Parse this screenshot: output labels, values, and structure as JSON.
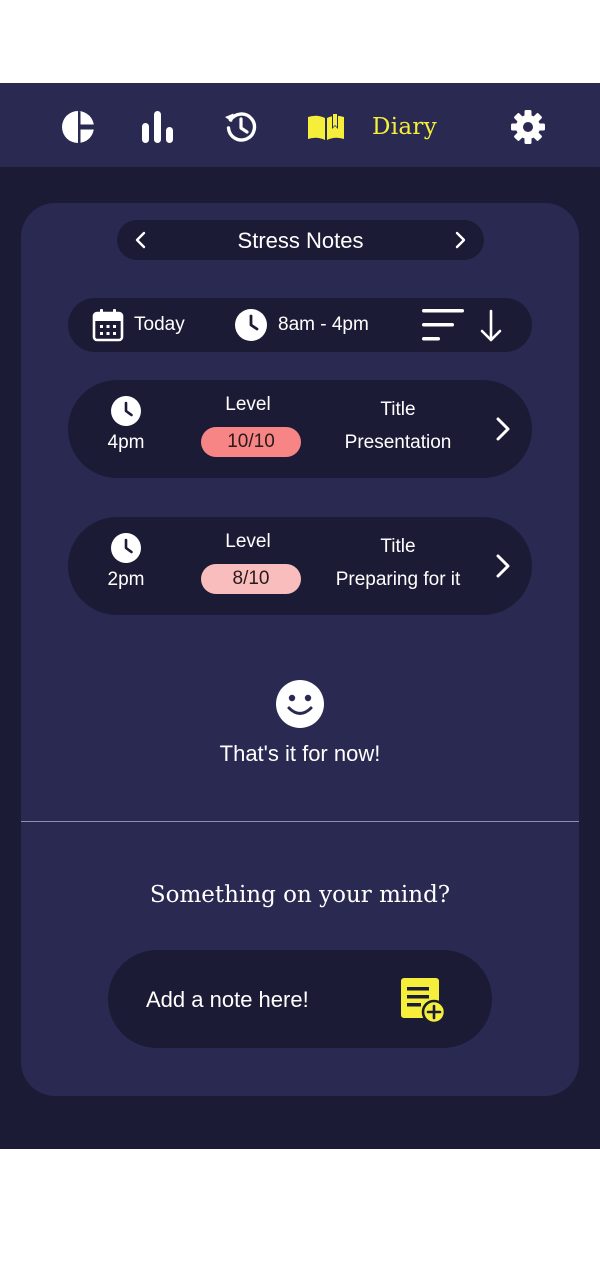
{
  "nav": {
    "icons": [
      "pie-chart-icon",
      "bar-chart-icon",
      "history-icon",
      "book-icon",
      "gear-icon"
    ],
    "active_label": "Diary",
    "accent_color": "#f5ee3a"
  },
  "header": {
    "title": "Stress Notes"
  },
  "filters": {
    "date_label": "Today",
    "time_range": "8am - 4pm"
  },
  "notes": [
    {
      "time": "4pm",
      "level_label": "Level",
      "level": "10/10",
      "level_color": "#f78585",
      "title_label": "Title",
      "title": "Presentation"
    },
    {
      "time": "2pm",
      "level_label": "Level",
      "level": "8/10",
      "level_color": "#f9bdbd",
      "title_label": "Title",
      "title": "Preparing for it"
    }
  ],
  "empty_state": {
    "message": "That's it for now!"
  },
  "compose": {
    "prompt": "Something on your mind?",
    "placeholder": "Add a note here!"
  },
  "colors": {
    "background": "#1c1b35",
    "card": "#292951",
    "accent": "#f5ee3a"
  }
}
